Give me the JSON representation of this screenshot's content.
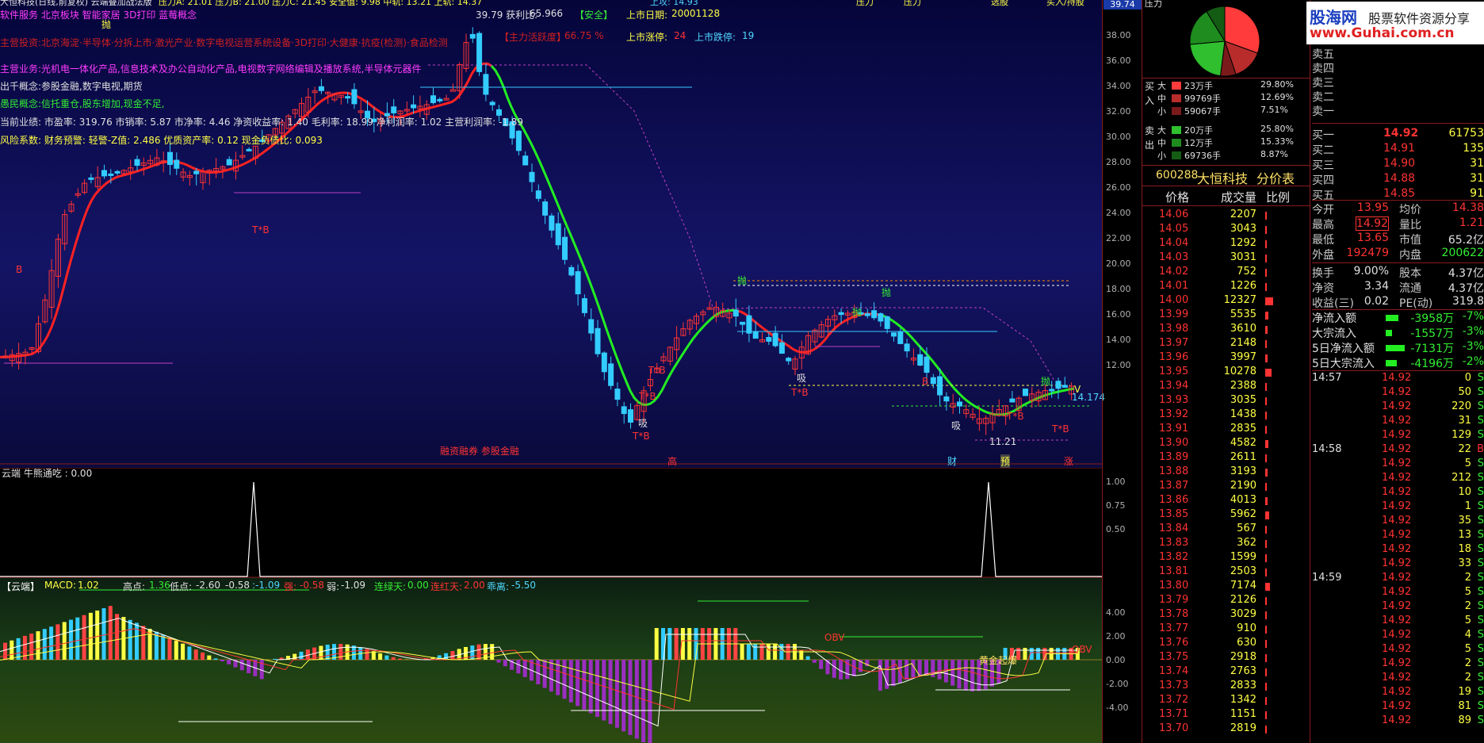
{
  "top_bar": {
    "left_text": "大恒科技(日线,前复权) 云端叠加战法版",
    "indicators": "压力A: 21.01  压力B: 21.00  压力C: 21.45  安全值: 9.98  中轨: 13.21  上轨: 14.37",
    "mid_text": "上攻: 14.93",
    "right_labels": [
      "压力",
      "压力",
      "选股",
      "买入/持股"
    ],
    "price_max": "39.74"
  },
  "info_lines": {
    "line1": "软件服务 北京板块 智能家居 3D打印 蓝莓概念",
    "ratio_label": "39.79 获利比:",
    "ratio_value": "65.966",
    "safety": "【安全】",
    "listing_label": "上市日期:",
    "listing_value": "20001128",
    "line2": "主营投资:北京海淀·半导体·分拆上市·激光产业·数字电视运营系统设备·3D打印·大健康·抗疫(检测)·食品检测",
    "active": "【主力活跃度】",
    "active_value": "66.75 %",
    "up_limit_label": "上市涨停:",
    "up_limit_value": "24",
    "down_limit_label": "上市跌停:",
    "down_limit_value": "19",
    "line3": "主营业务:光机电一体化产品,信息技术及办公自动化产品,电视数字网络编辑及播放系统,半导体元器件",
    "line4": "出千概念:参股金融,数字电视,期货",
    "line5": "愚民概念:信托重仓,股东增加,现金不足,",
    "line6": "当前业绩: 市盈率: 319.76 市销率: 5.87 市净率: 4.46 净资收益率: 1.40 毛利率: 18.99 净利润率: 1.02 主营利润率: -1.89",
    "line7": "风险系数: 财务预警: 轻警-Z值: 2.486 优质资产率: 0.12 现金负债比: 0.093"
  },
  "price_axis": [
    "38.00",
    "36.00",
    "34.00",
    "32.00",
    "30.00",
    "28.00",
    "26.00",
    "24.00",
    "22.00",
    "20.00",
    "18.00",
    "16.00",
    "14.00",
    "12.00"
  ],
  "chart_labels": {
    "bottom_note": "融资融券 参股金融",
    "bottom_markers": [
      "高",
      "财",
      "预",
      "涨"
    ],
    "sell": "抛",
    "buy": "B",
    "absorb": "吸",
    "tb": "T*B",
    "low_price": "11.21",
    "last_price": "14.174",
    "v_label": "V"
  },
  "osc": {
    "title": "云端 牛熊通吃 : 0.00",
    "axis": [
      "1.00",
      "0.75",
      "0.50"
    ]
  },
  "macd": {
    "title": "【云端】",
    "macd_label": "MACD:",
    "macd_value": "1.02",
    "high_label": "高点:",
    "high_value": "1.36",
    "low_label": "低点:",
    "low_value": "-2.60",
    "v1": "-0.58",
    "v2": ":-1.09",
    "strong_label": "强:",
    "strong_value": "-0.58",
    "weak_label": "弱:",
    "weak_value": "-1.09",
    "green_label": "连绿天:",
    "green_value": "0.00",
    "red_label": "连红天:",
    "red_value": "2.00",
    "dist_label": "乖离:",
    "dist_value": "-5.50",
    "axis": [
      "4.00",
      "2.00",
      "0.00",
      "-2.00",
      "-4.00"
    ],
    "gold_label": "黄金起爆",
    "obv_label": "OBV"
  },
  "trade_stats": {
    "buy_side": "买入",
    "sell_side": "卖出",
    "rows": [
      {
        "side": "大",
        "value": "23万手",
        "pct": "29.80%"
      },
      {
        "side": "中",
        "value": "99769手",
        "pct": "12.69%"
      },
      {
        "side": "小",
        "value": "59067手",
        "pct": "7.51%"
      },
      {
        "side": "大",
        "value": "20万手",
        "pct": "25.80%"
      },
      {
        "side": "中",
        "value": "12万手",
        "pct": "15.33%"
      },
      {
        "side": "小",
        "value": "69736手",
        "pct": "8.87%"
      }
    ],
    "code": "600288",
    "name": "大恒科技",
    "tab": "分价表",
    "head": [
      "价格",
      "成交量",
      "比例"
    ]
  },
  "price_table": [
    {
      "p": "14.06",
      "v": "2207"
    },
    {
      "p": "14.05",
      "v": "3043"
    },
    {
      "p": "14.04",
      "v": "1292"
    },
    {
      "p": "14.03",
      "v": "3031"
    },
    {
      "p": "14.02",
      "v": "752"
    },
    {
      "p": "14.01",
      "v": "1226"
    },
    {
      "p": "14.00",
      "v": "12327"
    },
    {
      "p": "13.99",
      "v": "5535"
    },
    {
      "p": "13.98",
      "v": "3610"
    },
    {
      "p": "13.97",
      "v": "2148"
    },
    {
      "p": "13.96",
      "v": "3997"
    },
    {
      "p": "13.95",
      "v": "10278"
    },
    {
      "p": "13.94",
      "v": "2388"
    },
    {
      "p": "13.93",
      "v": "3035"
    },
    {
      "p": "13.92",
      "v": "1438"
    },
    {
      "p": "13.91",
      "v": "2835"
    },
    {
      "p": "13.90",
      "v": "4582"
    },
    {
      "p": "13.89",
      "v": "2611"
    },
    {
      "p": "13.88",
      "v": "3193"
    },
    {
      "p": "13.87",
      "v": "2190"
    },
    {
      "p": "13.86",
      "v": "4013"
    },
    {
      "p": "13.85",
      "v": "5962"
    },
    {
      "p": "13.84",
      "v": "567"
    },
    {
      "p": "13.83",
      "v": "362"
    },
    {
      "p": "13.82",
      "v": "1599"
    },
    {
      "p": "13.81",
      "v": "2503"
    },
    {
      "p": "13.80",
      "v": "7174"
    },
    {
      "p": "13.79",
      "v": "2126"
    },
    {
      "p": "13.78",
      "v": "3029"
    },
    {
      "p": "13.77",
      "v": "910"
    },
    {
      "p": "13.76",
      "v": "630"
    },
    {
      "p": "13.75",
      "v": "2918"
    },
    {
      "p": "13.74",
      "v": "2763"
    },
    {
      "p": "13.73",
      "v": "2833"
    },
    {
      "p": "13.72",
      "v": "1342"
    },
    {
      "p": "13.71",
      "v": "1151"
    },
    {
      "p": "13.70",
      "v": "2819"
    }
  ],
  "logo": {
    "title": "股海网",
    "subtitle": "股票软件资源分享",
    "url": "www.Guhai.com.cn"
  },
  "order_book": {
    "sells": [
      "卖五",
      "卖四",
      "卖三",
      "卖二",
      "卖一"
    ],
    "buys": [
      {
        "label": "买一",
        "price": "14.92",
        "vol": "61753"
      },
      {
        "label": "买二",
        "price": "14.91",
        "vol": "135"
      },
      {
        "label": "买三",
        "price": "14.90",
        "vol": "31"
      },
      {
        "label": "买四",
        "price": "14.88",
        "vol": "31"
      },
      {
        "label": "买五",
        "price": "14.85",
        "vol": "91"
      }
    ]
  },
  "stats": [
    {
      "l": "今开",
      "v": "13.95",
      "l2": "均价",
      "v2": "14.38"
    },
    {
      "l": "最高",
      "v": "14.92",
      "l2": "量比",
      "v2": "1.21"
    },
    {
      "l": "最低",
      "v": "13.65",
      "l2": "市值",
      "v2": "65.2亿"
    },
    {
      "l": "外盘",
      "v": "192479",
      "l2": "内盘",
      "v2": "200622"
    },
    {
      "l": "换手",
      "v": "9.00%",
      "l2": "股本",
      "v2": "4.37亿"
    },
    {
      "l": "净资",
      "v": "3.34",
      "l2": "流通",
      "v2": "4.37亿"
    },
    {
      "l": "收益(三)",
      "v": "0.02",
      "l2": "PE(动)",
      "v2": "319.8"
    }
  ],
  "flows": [
    {
      "l": "净流入额",
      "v": "-3958万",
      "p": "-7%"
    },
    {
      "l": "大宗流入",
      "v": "-1557万",
      "p": "-3%"
    },
    {
      "l": "5日净流入额",
      "v": "-7131万",
      "p": "-3%"
    },
    {
      "l": "5日大宗流入",
      "v": "-4196万",
      "p": "-2%"
    }
  ],
  "time_sales": [
    {
      "t": "14:57",
      "p": "14.92",
      "v": "0",
      "s": "S"
    },
    {
      "t": "",
      "p": "14.92",
      "v": "50",
      "s": "S"
    },
    {
      "t": "",
      "p": "14.92",
      "v": "220",
      "s": "S"
    },
    {
      "t": "",
      "p": "14.92",
      "v": "31",
      "s": "S"
    },
    {
      "t": "",
      "p": "14.92",
      "v": "129",
      "s": "S"
    },
    {
      "t": "14:58",
      "p": "14.92",
      "v": "22",
      "s": "B"
    },
    {
      "t": "",
      "p": "14.92",
      "v": "5",
      "s": "S"
    },
    {
      "t": "",
      "p": "14.92",
      "v": "212",
      "s": "S"
    },
    {
      "t": "",
      "p": "14.92",
      "v": "10",
      "s": "S"
    },
    {
      "t": "",
      "p": "14.92",
      "v": "1",
      "s": "S"
    },
    {
      "t": "",
      "p": "14.92",
      "v": "35",
      "s": "S"
    },
    {
      "t": "",
      "p": "14.92",
      "v": "13",
      "s": "S"
    },
    {
      "t": "",
      "p": "14.92",
      "v": "18",
      "s": "S"
    },
    {
      "t": "",
      "p": "14.92",
      "v": "33",
      "s": "S"
    },
    {
      "t": "14:59",
      "p": "14.92",
      "v": "2",
      "s": "S"
    },
    {
      "t": "",
      "p": "14.92",
      "v": "5",
      "s": "S"
    },
    {
      "t": "",
      "p": "14.92",
      "v": "2",
      "s": "S"
    },
    {
      "t": "",
      "p": "14.92",
      "v": "5",
      "s": "S"
    },
    {
      "t": "",
      "p": "14.92",
      "v": "4",
      "s": "S"
    },
    {
      "t": "",
      "p": "14.92",
      "v": "5",
      "s": "S"
    },
    {
      "t": "",
      "p": "14.92",
      "v": "2",
      "s": "S"
    },
    {
      "t": "",
      "p": "14.92",
      "v": "2",
      "s": "S"
    },
    {
      "t": "",
      "p": "14.92",
      "v": "19",
      "s": "S"
    },
    {
      "t": "",
      "p": "14.92",
      "v": "81",
      "s": "S"
    },
    {
      "t": "",
      "p": "14.92",
      "v": "89",
      "s": "S"
    }
  ],
  "colors": {
    "up": "#ff3333",
    "down": "#33ccff",
    "ma_up": "#ff2222",
    "ma_down": "#22ee22",
    "frame": "#8a1a1a"
  }
}
